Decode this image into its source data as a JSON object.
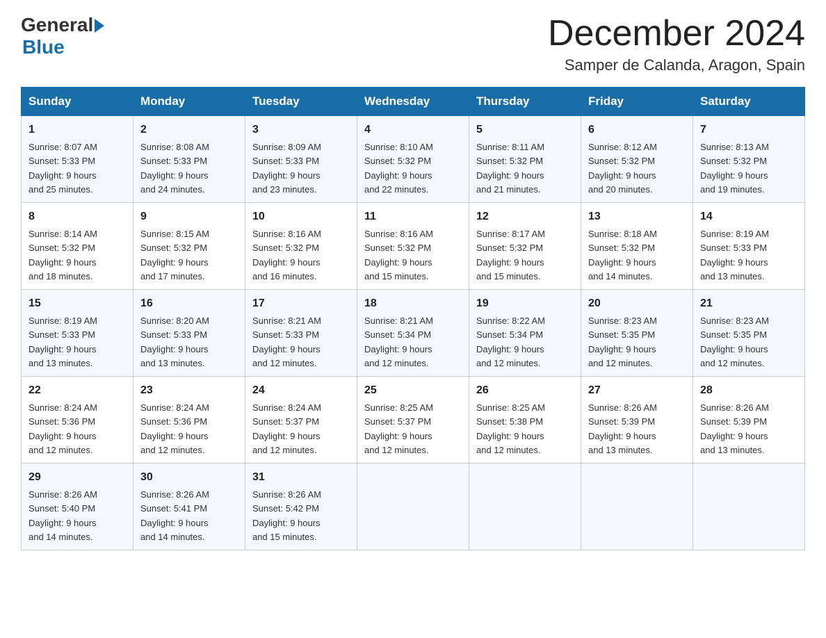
{
  "header": {
    "logo_general": "General",
    "logo_blue": "Blue",
    "month_title": "December 2024",
    "location": "Samper de Calanda, Aragon, Spain"
  },
  "days_of_week": [
    "Sunday",
    "Monday",
    "Tuesday",
    "Wednesday",
    "Thursday",
    "Friday",
    "Saturday"
  ],
  "weeks": [
    [
      {
        "day": "1",
        "sunrise": "8:07 AM",
        "sunset": "5:33 PM",
        "daylight": "9 hours and 25 minutes."
      },
      {
        "day": "2",
        "sunrise": "8:08 AM",
        "sunset": "5:33 PM",
        "daylight": "9 hours and 24 minutes."
      },
      {
        "day": "3",
        "sunrise": "8:09 AM",
        "sunset": "5:33 PM",
        "daylight": "9 hours and 23 minutes."
      },
      {
        "day": "4",
        "sunrise": "8:10 AM",
        "sunset": "5:32 PM",
        "daylight": "9 hours and 22 minutes."
      },
      {
        "day": "5",
        "sunrise": "8:11 AM",
        "sunset": "5:32 PM",
        "daylight": "9 hours and 21 minutes."
      },
      {
        "day": "6",
        "sunrise": "8:12 AM",
        "sunset": "5:32 PM",
        "daylight": "9 hours and 20 minutes."
      },
      {
        "day": "7",
        "sunrise": "8:13 AM",
        "sunset": "5:32 PM",
        "daylight": "9 hours and 19 minutes."
      }
    ],
    [
      {
        "day": "8",
        "sunrise": "8:14 AM",
        "sunset": "5:32 PM",
        "daylight": "9 hours and 18 minutes."
      },
      {
        "day": "9",
        "sunrise": "8:15 AM",
        "sunset": "5:32 PM",
        "daylight": "9 hours and 17 minutes."
      },
      {
        "day": "10",
        "sunrise": "8:16 AM",
        "sunset": "5:32 PM",
        "daylight": "9 hours and 16 minutes."
      },
      {
        "day": "11",
        "sunrise": "8:16 AM",
        "sunset": "5:32 PM",
        "daylight": "9 hours and 15 minutes."
      },
      {
        "day": "12",
        "sunrise": "8:17 AM",
        "sunset": "5:32 PM",
        "daylight": "9 hours and 15 minutes."
      },
      {
        "day": "13",
        "sunrise": "8:18 AM",
        "sunset": "5:32 PM",
        "daylight": "9 hours and 14 minutes."
      },
      {
        "day": "14",
        "sunrise": "8:19 AM",
        "sunset": "5:33 PM",
        "daylight": "9 hours and 13 minutes."
      }
    ],
    [
      {
        "day": "15",
        "sunrise": "8:19 AM",
        "sunset": "5:33 PM",
        "daylight": "9 hours and 13 minutes."
      },
      {
        "day": "16",
        "sunrise": "8:20 AM",
        "sunset": "5:33 PM",
        "daylight": "9 hours and 13 minutes."
      },
      {
        "day": "17",
        "sunrise": "8:21 AM",
        "sunset": "5:33 PM",
        "daylight": "9 hours and 12 minutes."
      },
      {
        "day": "18",
        "sunrise": "8:21 AM",
        "sunset": "5:34 PM",
        "daylight": "9 hours and 12 minutes."
      },
      {
        "day": "19",
        "sunrise": "8:22 AM",
        "sunset": "5:34 PM",
        "daylight": "9 hours and 12 minutes."
      },
      {
        "day": "20",
        "sunrise": "8:23 AM",
        "sunset": "5:35 PM",
        "daylight": "9 hours and 12 minutes."
      },
      {
        "day": "21",
        "sunrise": "8:23 AM",
        "sunset": "5:35 PM",
        "daylight": "9 hours and 12 minutes."
      }
    ],
    [
      {
        "day": "22",
        "sunrise": "8:24 AM",
        "sunset": "5:36 PM",
        "daylight": "9 hours and 12 minutes."
      },
      {
        "day": "23",
        "sunrise": "8:24 AM",
        "sunset": "5:36 PM",
        "daylight": "9 hours and 12 minutes."
      },
      {
        "day": "24",
        "sunrise": "8:24 AM",
        "sunset": "5:37 PM",
        "daylight": "9 hours and 12 minutes."
      },
      {
        "day": "25",
        "sunrise": "8:25 AM",
        "sunset": "5:37 PM",
        "daylight": "9 hours and 12 minutes."
      },
      {
        "day": "26",
        "sunrise": "8:25 AM",
        "sunset": "5:38 PM",
        "daylight": "9 hours and 12 minutes."
      },
      {
        "day": "27",
        "sunrise": "8:26 AM",
        "sunset": "5:39 PM",
        "daylight": "9 hours and 13 minutes."
      },
      {
        "day": "28",
        "sunrise": "8:26 AM",
        "sunset": "5:39 PM",
        "daylight": "9 hours and 13 minutes."
      }
    ],
    [
      {
        "day": "29",
        "sunrise": "8:26 AM",
        "sunset": "5:40 PM",
        "daylight": "9 hours and 14 minutes."
      },
      {
        "day": "30",
        "sunrise": "8:26 AM",
        "sunset": "5:41 PM",
        "daylight": "9 hours and 14 minutes."
      },
      {
        "day": "31",
        "sunrise": "8:26 AM",
        "sunset": "5:42 PM",
        "daylight": "9 hours and 15 minutes."
      },
      null,
      null,
      null,
      null
    ]
  ],
  "labels": {
    "sunrise": "Sunrise:",
    "sunset": "Sunset:",
    "daylight": "Daylight:"
  }
}
